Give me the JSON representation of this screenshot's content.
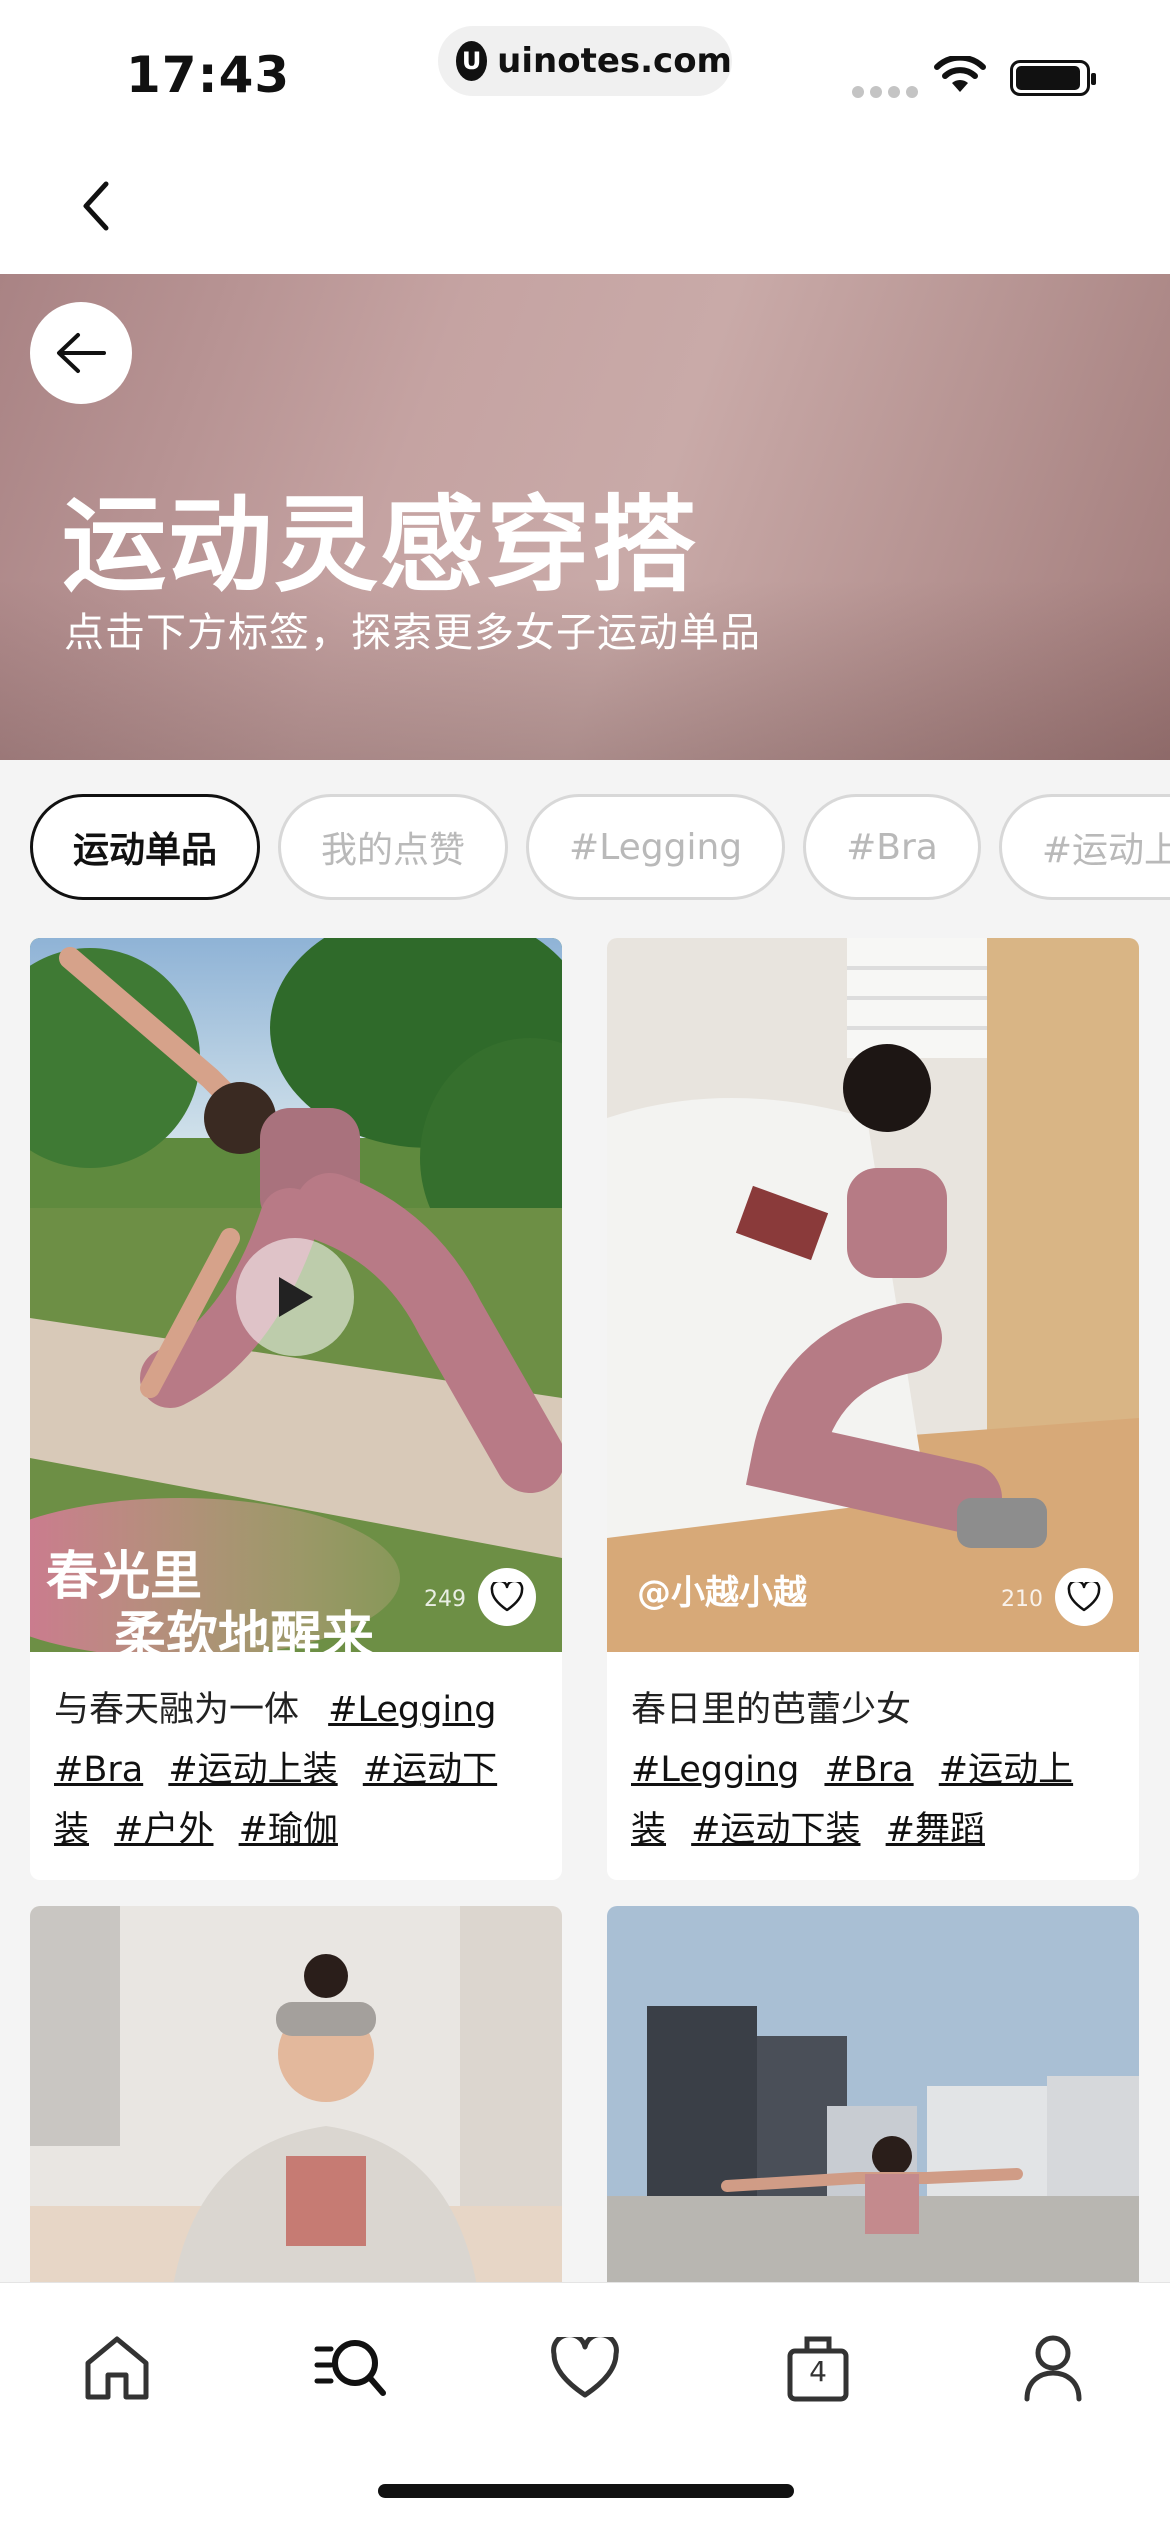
{
  "status_bar": {
    "time": "17:43",
    "url_logo": "U",
    "url": "uinotes.com"
  },
  "hero": {
    "title": "运动灵感穿搭",
    "subtitle": "点击下方标签，探索更多女子运动单品"
  },
  "filters": [
    {
      "label": "运动单品",
      "active": true
    },
    {
      "label": "我的点赞",
      "active": false
    },
    {
      "label": "#Legging",
      "active": false
    },
    {
      "label": "#Bra",
      "active": false
    },
    {
      "label": "#运动上装",
      "active": false
    }
  ],
  "cards": [
    {
      "overlay_line1": "春光里",
      "overlay_line2": "柔软地醒来",
      "likes": "249",
      "title": "与春天融为一体",
      "tags": [
        "#Legging",
        "#Bra",
        "#运动上装",
        "#运动下装",
        "#户外",
        "#瑜伽"
      ]
    },
    {
      "handle": "@小越小越",
      "likes": "210",
      "title": "春日里的芭蕾少女",
      "tags": [
        "#Legging",
        "#Bra",
        "#运动上装",
        "#运动下装",
        "#舞蹈"
      ]
    }
  ],
  "tab_bar": {
    "items": [
      {
        "icon": "home-icon"
      },
      {
        "icon": "search-list-icon"
      },
      {
        "icon": "heart-icon"
      },
      {
        "icon": "bag-icon",
        "badge": "4"
      },
      {
        "icon": "profile-icon"
      }
    ]
  },
  "colors": {
    "hero_bg": "#b99594",
    "accent": "#111111",
    "chip_inactive": "#b9b9b9"
  }
}
